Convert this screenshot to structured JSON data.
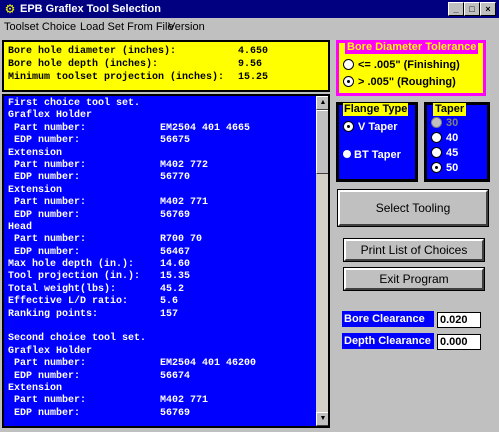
{
  "window": {
    "title": "EPB Graflex Tool Selection",
    "icon": "tool-icon",
    "minimize": "_",
    "maximize": "□",
    "close": "×"
  },
  "menu": [
    "Toolset Choice",
    "Load Set From File",
    "Version"
  ],
  "summary": [
    {
      "label": "Bore hole diameter (inches):",
      "value": "4.650"
    },
    {
      "label": "Bore hole depth (inches):",
      "value": "9.56"
    },
    {
      "label": "Minimum toolset projection (inches):",
      "value": "15.25"
    }
  ],
  "results": [
    {
      "label": "First choice tool set.",
      "value": ""
    },
    {
      "label": "Graflex Holder",
      "value": ""
    },
    {
      "label": " Part number:",
      "value": "EM2504 401 4665"
    },
    {
      "label": " EDP number:",
      "value": "56675"
    },
    {
      "label": "Extension",
      "value": ""
    },
    {
      "label": " Part number:",
      "value": "M402 772"
    },
    {
      "label": " EDP number:",
      "value": "56770"
    },
    {
      "label": "Extension",
      "value": ""
    },
    {
      "label": " Part number:",
      "value": "M402 771"
    },
    {
      "label": " EDP number:",
      "value": "56769"
    },
    {
      "label": "Head",
      "value": ""
    },
    {
      "label": " Part number:",
      "value": "R700 70"
    },
    {
      "label": " EDP number:",
      "value": "56467"
    },
    {
      "label": "Max hole depth (in.):",
      "value": "14.60"
    },
    {
      "label": "Tool projection (in.):",
      "value": "15.35"
    },
    {
      "label": "Total weight(lbs):",
      "value": "45.2"
    },
    {
      "label": "Effective L/D ratio:",
      "value": "5.6"
    },
    {
      "label": "Ranking points:",
      "value": "157"
    },
    {
      "label": "",
      "value": ""
    },
    {
      "label": "Second choice tool set.",
      "value": ""
    },
    {
      "label": "Graflex Holder",
      "value": ""
    },
    {
      "label": " Part number:",
      "value": "EM2504 401 46200"
    },
    {
      "label": " EDP number:",
      "value": "56674"
    },
    {
      "label": "Extension",
      "value": ""
    },
    {
      "label": " Part number:",
      "value": "M402 771"
    },
    {
      "label": " EDP number:",
      "value": "56769"
    }
  ],
  "bore_tolerance": {
    "title": "Bore Diameter Tolerance",
    "options": [
      {
        "label": "<= .005\" (Finishing)",
        "selected": false
      },
      {
        "label": "> .005\" (Roughing)",
        "selected": true
      }
    ]
  },
  "flange_type": {
    "title": "Flange Type",
    "options": [
      {
        "label": "V Taper",
        "selected": true
      },
      {
        "label": "BT Taper",
        "selected": false
      }
    ]
  },
  "taper": {
    "title": "Taper",
    "options": [
      {
        "label": "30",
        "selected": false,
        "disabled": true
      },
      {
        "label": "40",
        "selected": false,
        "disabled": false
      },
      {
        "label": "45",
        "selected": false,
        "disabled": false
      },
      {
        "label": "50",
        "selected": true,
        "disabled": false
      }
    ]
  },
  "buttons": {
    "select_tooling": "Select Tooling",
    "print_list": "Print List of Choices",
    "exit": "Exit Program"
  },
  "clearances": {
    "bore_label": "Bore Clearance",
    "bore_value": "0.020",
    "depth_label": "Depth Clearance",
    "depth_value": "0.000"
  },
  "colors": {
    "title_bar": "#000080",
    "list_bg": "#0000ff",
    "info_bg": "#ffff00",
    "tolerance_border": "#ff00ff"
  }
}
